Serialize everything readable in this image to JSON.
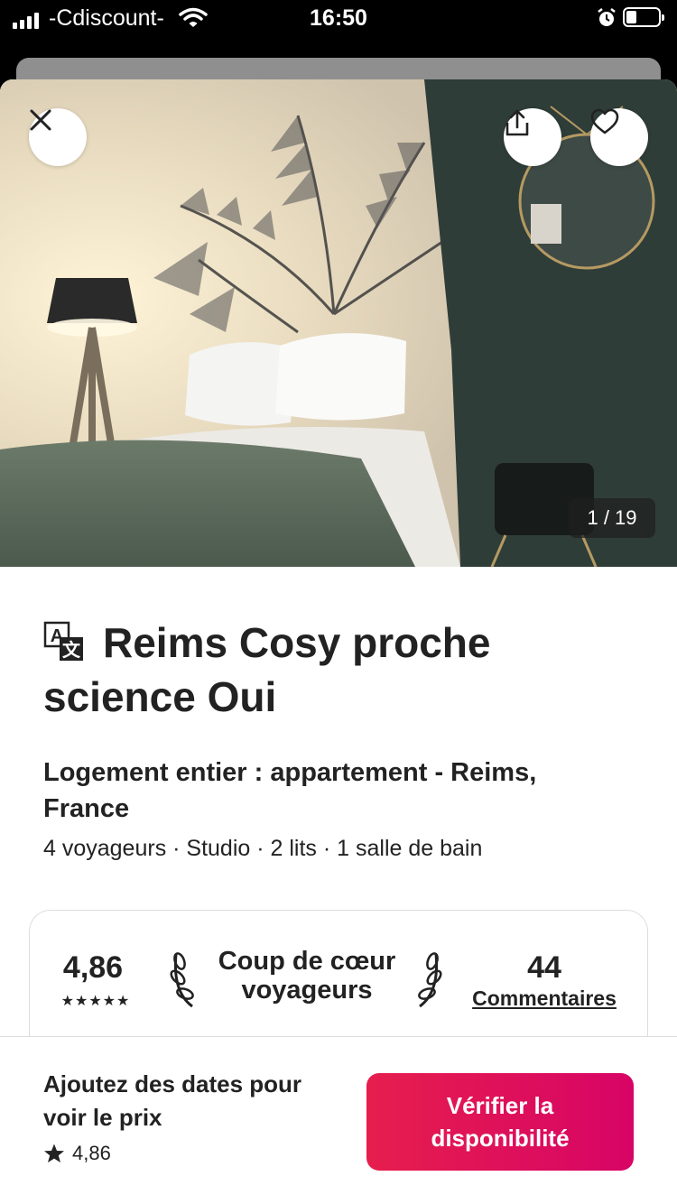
{
  "status_bar": {
    "carrier": "-Cdiscount-",
    "time": "16:50",
    "icons": [
      "signal-icon",
      "wifi-icon",
      "alarm-icon",
      "battery-icon"
    ]
  },
  "listing": {
    "photo_counter": "1 / 19",
    "title": "Reims Cosy proche science Oui",
    "subtitle": "Logement entier : appartement - Reims, France",
    "details": "4 voyageurs · Studio · 2 lits · 1 salle de bain",
    "icons": [
      "close-icon",
      "share-icon",
      "heart-icon",
      "translate-icon"
    ]
  },
  "stats": {
    "rating": "4,86",
    "stars": "★★★★★",
    "badge": "Coup de cœur voyageurs",
    "review_count": "44",
    "reviews_label": "Commentaires"
  },
  "booking": {
    "price_prompt": "Ajoutez des dates pour voir le prix",
    "rating": "4,86",
    "cta_label": "Vérifier la disponibilité"
  },
  "colors": {
    "accent": "#e61e4d",
    "accent_end": "#d70466",
    "text": "#222222"
  }
}
